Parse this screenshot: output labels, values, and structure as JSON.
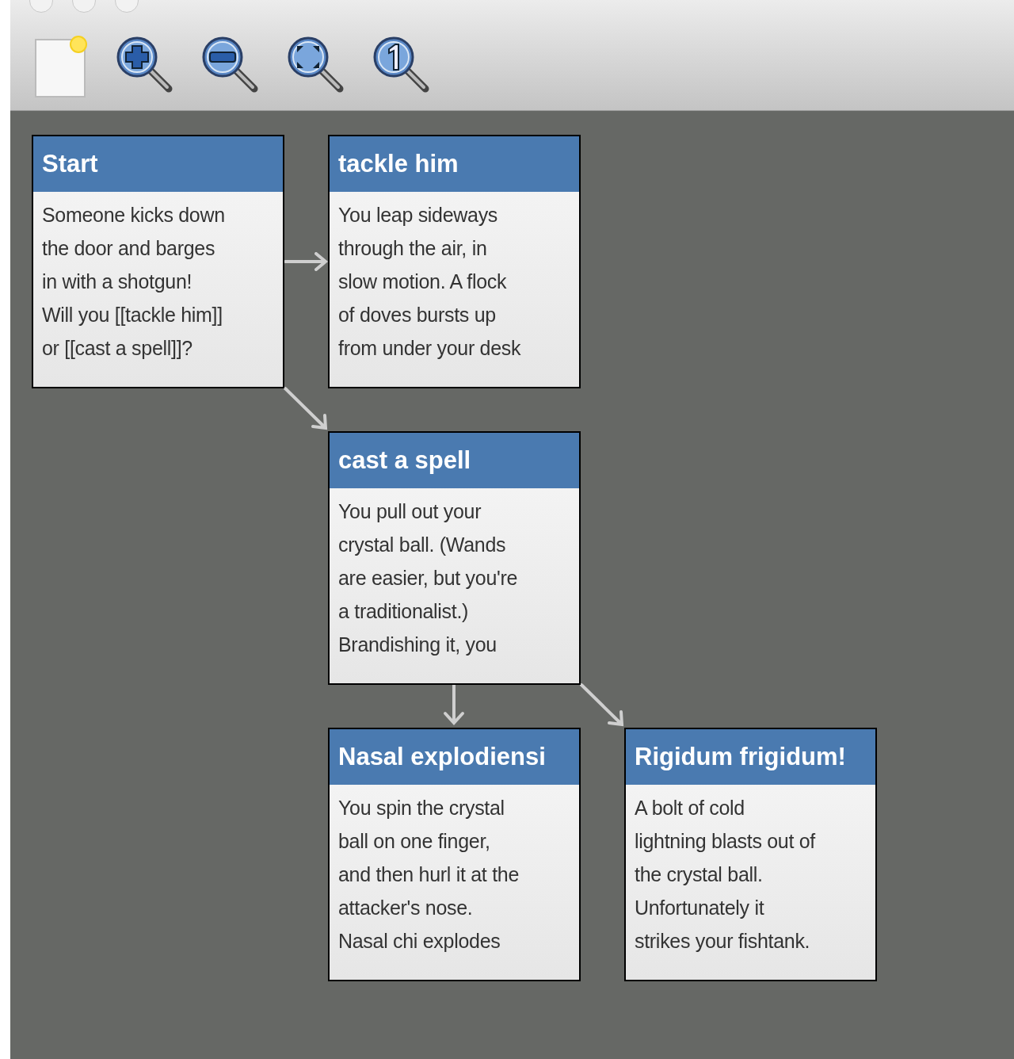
{
  "toolbar": {
    "buttons": [
      {
        "kind": "new"
      },
      {
        "kind": "zoom_in"
      },
      {
        "kind": "zoom_out"
      },
      {
        "kind": "zoom_fit"
      },
      {
        "kind": "zoom_actual"
      }
    ]
  },
  "passages": [
    {
      "title": "Start",
      "lines": [
        "Someone kicks down",
        "the door and barges",
        "in with a shotgun!",
        "Will you [[tackle him]]",
        "or [[cast a spell]]?"
      ]
    },
    {
      "title": "tackle him",
      "lines": [
        "You leap sideways",
        "through the air, in",
        "slow motion. A flock",
        "of doves bursts up",
        "from under your desk"
      ]
    },
    {
      "title": "cast a spell",
      "lines": [
        "You pull out your",
        "crystal ball. (Wands",
        "are easier, but you're",
        "a traditionalist.)",
        "Brandishing it, you"
      ]
    },
    {
      "title": "Nasal explodiensi",
      "lines": [
        "You spin the crystal",
        "ball on one finger,",
        "and then hurl it at the",
        "attacker's nose.",
        "Nasal chi explodes"
      ]
    },
    {
      "title": "Rigidum frigidum!",
      "lines": [
        "A bolt of cold",
        "lightning blasts out of",
        "the crystal ball.",
        "Unfortunately it",
        "strikes your fishtank."
      ]
    }
  ]
}
